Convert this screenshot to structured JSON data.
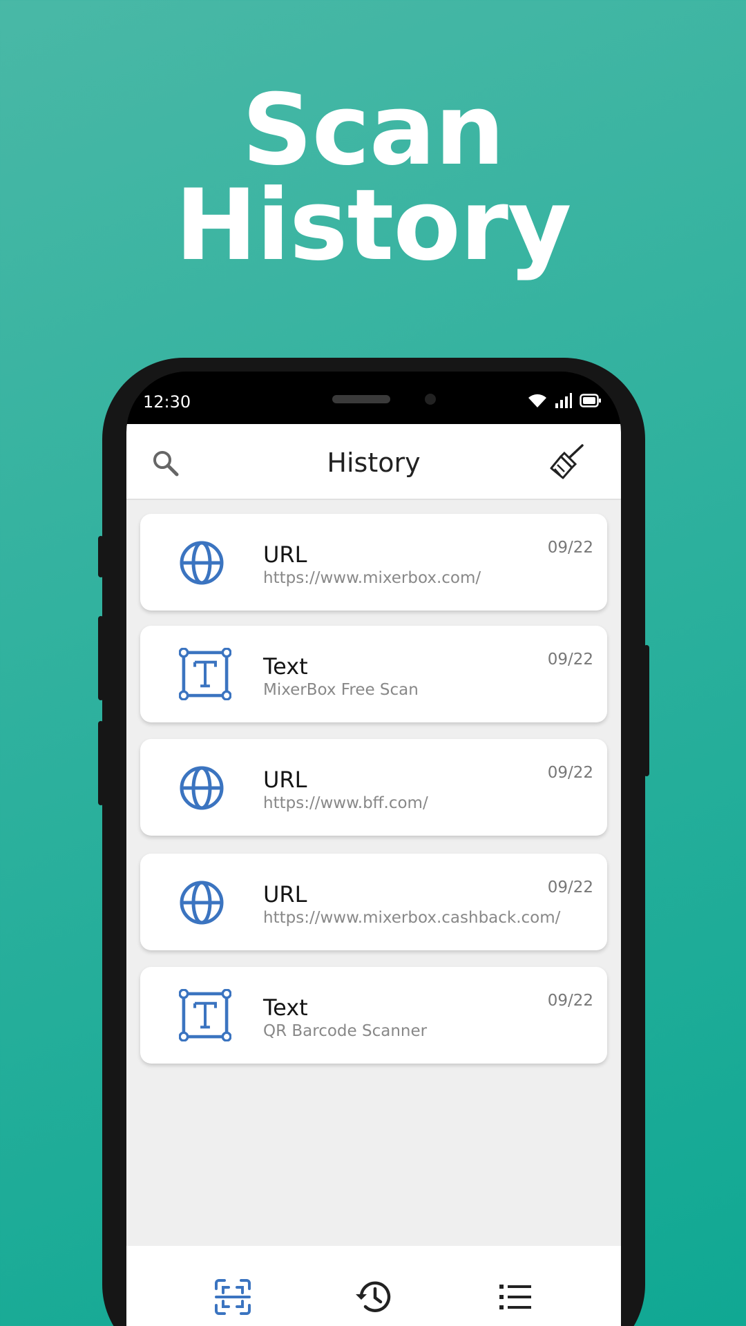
{
  "headline": {
    "line1": "Scan",
    "line2": "History"
  },
  "status_bar": {
    "time": "12:30",
    "icons": [
      "wifi-icon",
      "signal-icon",
      "battery-icon"
    ]
  },
  "app_bar": {
    "title": "History",
    "left_icon": "search-icon",
    "right_icon": "broom-icon"
  },
  "colors": {
    "accent_blue": "#3b74c0",
    "background_teal": "#2fb19e"
  },
  "history": [
    {
      "type": "URL",
      "value": "https://www.mixerbox.com/",
      "date": "09/22",
      "icon": "globe-icon"
    },
    {
      "type": "Text",
      "value": "MixerBox Free Scan",
      "date": "09/22",
      "icon": "text-icon"
    },
    {
      "type": "URL",
      "value": "https://www.bff.com/",
      "date": "09/22",
      "icon": "globe-icon"
    },
    {
      "type": "URL",
      "value": "https://www.mixerbox.cashback.com/",
      "date": "09/22",
      "icon": "globe-icon"
    },
    {
      "type": "Text",
      "value": "QR Barcode Scanner",
      "date": "09/22",
      "icon": "text-icon"
    }
  ],
  "bottom_nav": [
    {
      "name": "scan",
      "icon": "scan-icon",
      "active": true
    },
    {
      "name": "history",
      "icon": "history-icon",
      "active": false
    },
    {
      "name": "list",
      "icon": "list-icon",
      "active": false
    }
  ]
}
